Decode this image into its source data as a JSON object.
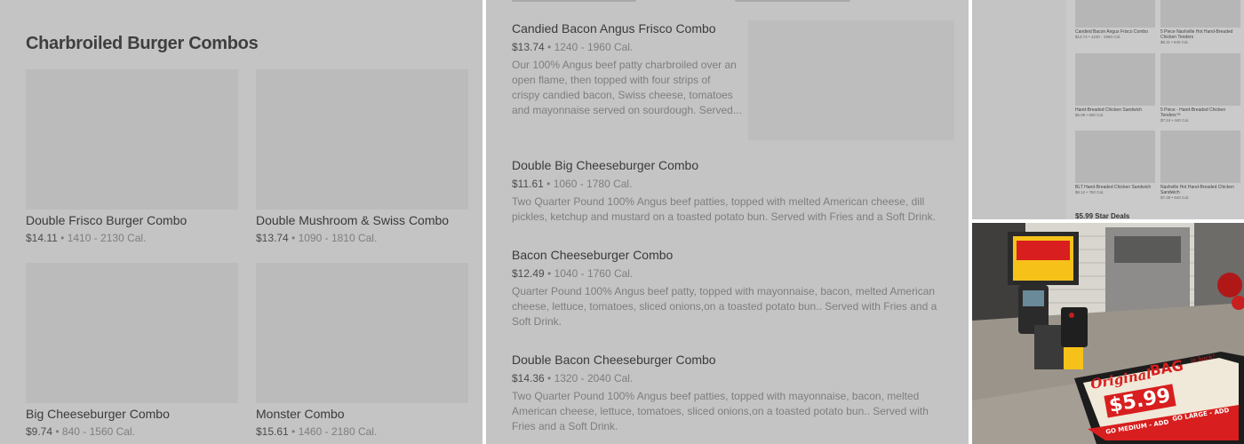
{
  "left_panel": {
    "section_title": "Charbroiled Burger Combos",
    "cards": [
      {
        "name": "Double Frisco Burger Combo",
        "price": "$14.11",
        "sep": " • ",
        "calories": "1410 - 2130 Cal."
      },
      {
        "name": "Double Mushroom & Swiss Combo",
        "price": "$13.74",
        "sep": " • ",
        "calories": "1090 - 1810 Cal."
      },
      {
        "name": "Big Cheeseburger Combo",
        "price": "$9.74",
        "sep": " • ",
        "calories": "840 - 1560 Cal."
      },
      {
        "name": "Monster Combo",
        "price": "$15.61",
        "sep": " • ",
        "calories": "1460 - 2180 Cal."
      }
    ]
  },
  "middle_panel": {
    "items": [
      {
        "name": "Candied Bacon Angus Frisco Combo",
        "price": "$13.74",
        "sep": " • ",
        "calories": "1240 - 1960 Cal.",
        "description_lines": [
          "Our 100% Angus beef patty charbroiled over an",
          "open flame, then topped with four strips of",
          "crispy candied bacon, Swiss cheese, tomatoes",
          "and mayonnaise served on sourdough. Served..."
        ]
      },
      {
        "name": "Double Big Cheeseburger Combo",
        "price": "$11.61",
        "sep": " • ",
        "calories": "1060 - 1780 Cal.",
        "description_lines": [
          "Two Quarter Pound 100% Angus beef patties, topped with melted American cheese, dill",
          "pickles, ketchup and mustard on a toasted potato bun. Served with Fries and a Soft Drink."
        ]
      },
      {
        "name": "Bacon Cheeseburger Combo",
        "price": "$12.49",
        "sep": " • ",
        "calories": "1040 - 1760 Cal.",
        "description_lines": [
          "Quarter Pound 100% Angus beef patty, topped with mayonnaise, bacon, melted American",
          "cheese, lettuce, tomatoes, sliced onions,on a toasted potato bun.. Served with Fries and a",
          "Soft Drink."
        ]
      },
      {
        "name": "Double Bacon Cheeseburger Combo",
        "price": "$14.36",
        "sep": " • ",
        "calories": "1320 - 2040 Cal.",
        "description_lines": [
          "Two Quarter Pound 100% Angus beef patties, topped with mayonnaise, bacon, melted",
          "American cheese, lettuce, tomatoes, sliced onions,on a toasted potato bun.. Served with",
          "Fries and a Soft Drink."
        ]
      }
    ]
  },
  "right_top_panel": {
    "mini_items": [
      {
        "name": "Candied Bacon Angus Frisco Combo",
        "meta": "$13.74 • 1240 - 1960 Cal."
      },
      {
        "name": "5 Piece Nashville Hot Hand-Breaded Chicken Tenders",
        "meta": "$8.11 • 640 Cal."
      },
      {
        "name": "Hand-Breaded Chicken Sandwich",
        "meta": "$5.99 • 600 Cal."
      },
      {
        "name": "5 Piece - Hand-Breaded Chicken Tenders™",
        "meta": "$7.24 • 440 Cal."
      },
      {
        "name": "BLT Hand-Breaded Chicken Sandwich",
        "meta": "$8.12 • 750 Cal."
      },
      {
        "name": "Nashville Hot Hand-Breaded Chicken Sandwich",
        "meta": "$7.49 • 640 Cal."
      }
    ],
    "deal_title": "$5.99 Star Deals"
  },
  "right_bottom_photo": {
    "sign_top_line": "Original",
    "sign_bag": "BAG",
    "sign_back": "is back!",
    "sign_price": "$5.99",
    "sign_go_medium": "GO MEDIUM - ADD",
    "sign_go_large": "GO LARGE - ADD",
    "colors": {
      "sign_red": "#d81e1e",
      "sign_yellow": "#f6c21a",
      "counter": "#9b948b"
    }
  }
}
